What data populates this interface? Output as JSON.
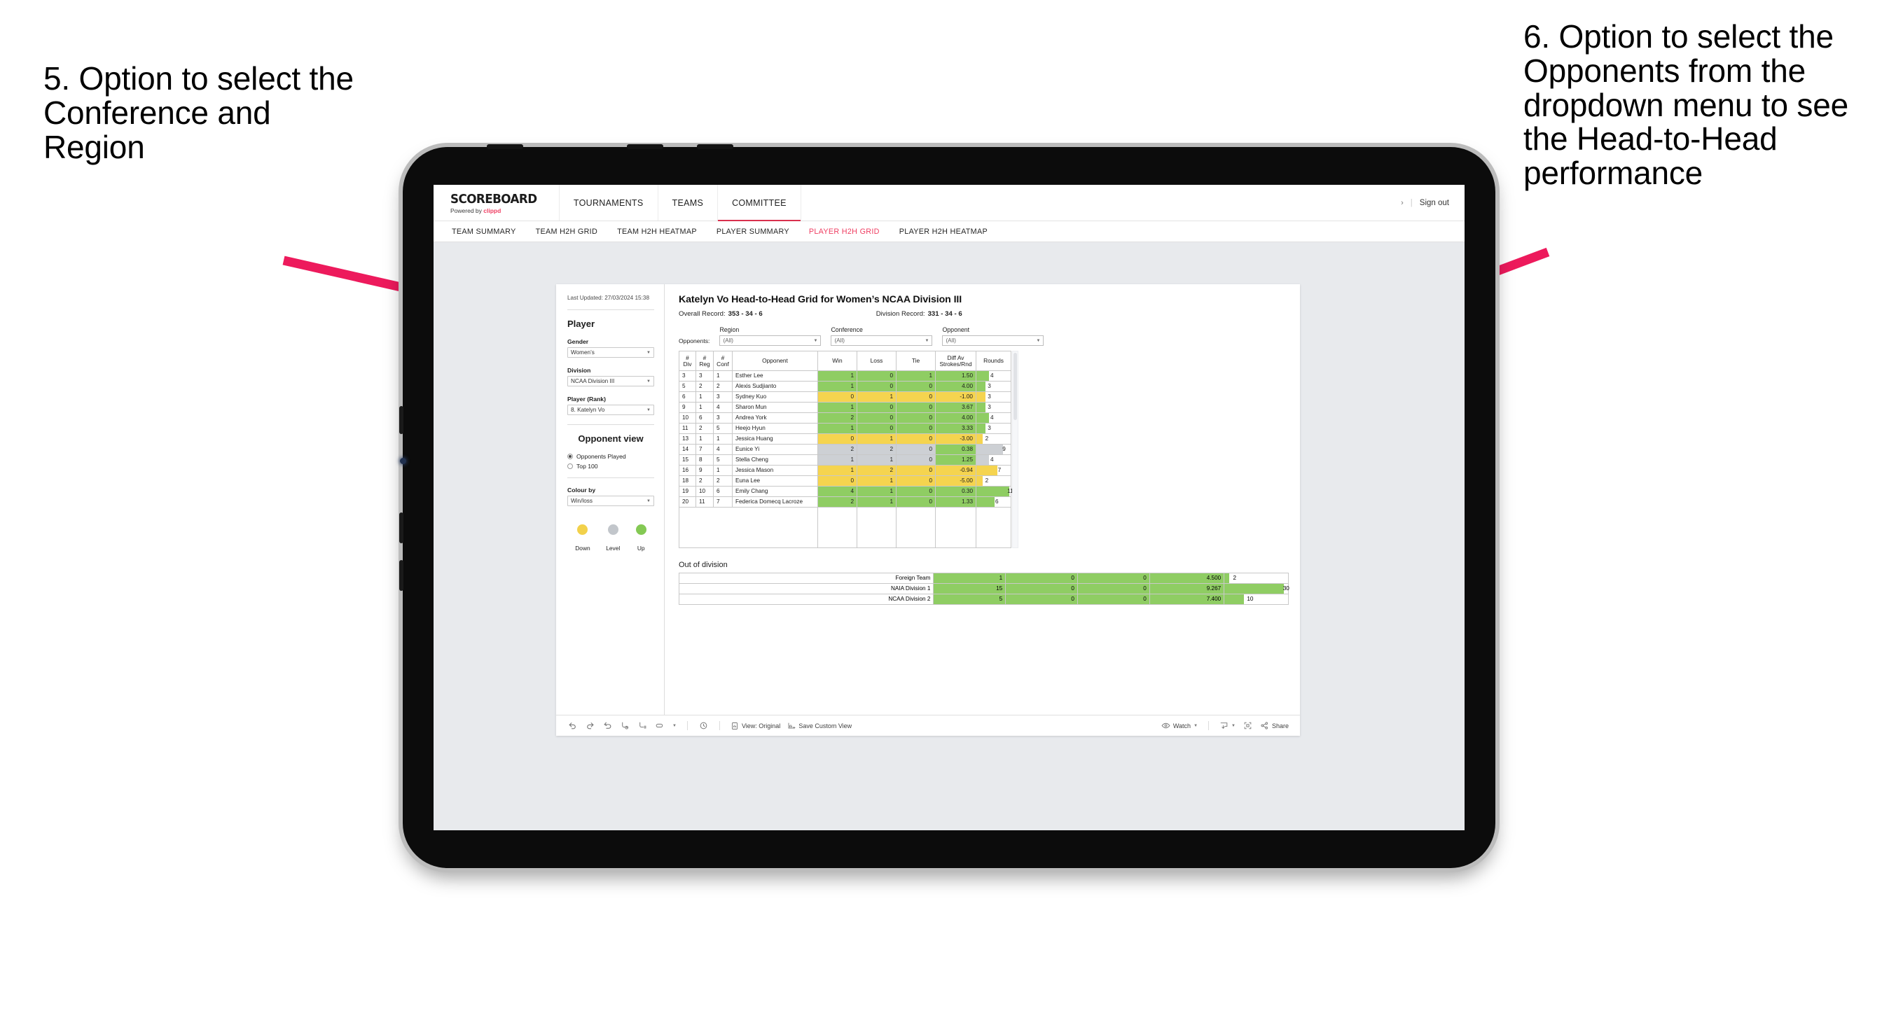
{
  "annotations": {
    "left": "5. Option to select the Conference and Region",
    "right": "6. Option to select the Opponents from the dropdown menu to see the Head-to-Head performance",
    "arrow_color": "#ed1a5c"
  },
  "app": {
    "brand": {
      "wordmark": "SCOREBOARD",
      "powered_prefix": "Powered by ",
      "powered_brand": "clippd"
    },
    "topnav": [
      {
        "label": "TOURNAMENTS",
        "active": false
      },
      {
        "label": "TEAMS",
        "active": false
      },
      {
        "label": "COMMITTEE",
        "active": true
      }
    ],
    "topright": {
      "chevron": "›",
      "separator": "|",
      "sign_out": "Sign out"
    },
    "subnav": [
      {
        "label": "TEAM SUMMARY",
        "active": false
      },
      {
        "label": "TEAM H2H GRID",
        "active": false
      },
      {
        "label": "TEAM H2H HEATMAP",
        "active": false
      },
      {
        "label": "PLAYER SUMMARY",
        "active": false
      },
      {
        "label": "PLAYER H2H GRID",
        "active": true
      },
      {
        "label": "PLAYER H2H HEATMAP",
        "active": false
      }
    ]
  },
  "sidebar": {
    "last_updated": "Last Updated: 27/03/2024 15:38",
    "player_heading": "Player",
    "fields": [
      {
        "label": "Gender",
        "value": "Women’s"
      },
      {
        "label": "Division",
        "value": "NCAA Division III"
      },
      {
        "label": "Player (Rank)",
        "value": "8. Katelyn Vo"
      }
    ],
    "opponent_view_heading": "Opponent view",
    "opponent_view_options": [
      {
        "label": "Opponents Played",
        "selected": true
      },
      {
        "label": "Top 100",
        "selected": false
      }
    ],
    "colour_by": {
      "label": "Colour by",
      "value": "Win/loss"
    },
    "legend": [
      {
        "label": "Down",
        "color": "#f2d14b"
      },
      {
        "label": "Level",
        "color": "#c2c6cb"
      },
      {
        "label": "Up",
        "color": "#84c954"
      }
    ]
  },
  "main": {
    "title": "Katelyn Vo Head-to-Head Grid for Women’s NCAA Division III",
    "overall_record_label": "Overall Record:",
    "overall_record_value": "353 - 34 - 6",
    "division_record_label": "Division Record:",
    "division_record_value": "331 - 34 - 6",
    "opponents_label": "Opponents:",
    "filters": [
      {
        "label": "Region",
        "value": "(All)"
      },
      {
        "label": "Conference",
        "value": "(All)"
      },
      {
        "label": "Opponent",
        "value": "(All)"
      }
    ],
    "out_of_division_heading": "Out of division"
  },
  "chart_data": {
    "type": "table",
    "title": "Katelyn Vo Head-to-Head Grid for Women’s NCAA Division III",
    "columns": [
      "# Div",
      "# Reg",
      "# Conf",
      "Opponent",
      "Win",
      "Loss",
      "Tie",
      "Diff Av Strokes/Rnd",
      "Rounds"
    ],
    "column_headers_split": [
      {
        "line1": "#",
        "line2": "Div"
      },
      {
        "line1": "#",
        "line2": "Reg"
      },
      {
        "line1": "#",
        "line2": "Conf"
      },
      {
        "line1": "Opponent",
        "line2": ""
      },
      {
        "line1": "Win",
        "line2": ""
      },
      {
        "line1": "Loss",
        "line2": ""
      },
      {
        "line1": "Tie",
        "line2": ""
      },
      {
        "line1": "Diff Av",
        "line2": "Strokes/Rnd"
      },
      {
        "line1": "Rounds",
        "line2": ""
      }
    ],
    "rows": [
      {
        "div": "3",
        "reg": "3",
        "conf": "1",
        "opponent": "Esther Lee",
        "win": "1",
        "loss": "0",
        "tie": "1",
        "diff": "1.50",
        "rounds": "4",
        "state": "up",
        "bar_pct": 36
      },
      {
        "div": "5",
        "reg": "2",
        "conf": "2",
        "opponent": "Alexis Sudjianto",
        "win": "1",
        "loss": "0",
        "tie": "0",
        "diff": "4.00",
        "rounds": "3",
        "state": "up",
        "bar_pct": 27
      },
      {
        "div": "6",
        "reg": "1",
        "conf": "3",
        "opponent": "Sydney Kuo",
        "win": "0",
        "loss": "1",
        "tie": "0",
        "diff": "-1.00",
        "rounds": "3",
        "state": "down",
        "bar_pct": 27
      },
      {
        "div": "9",
        "reg": "1",
        "conf": "4",
        "opponent": "Sharon Mun",
        "win": "1",
        "loss": "0",
        "tie": "0",
        "diff": "3.67",
        "rounds": "3",
        "state": "up",
        "bar_pct": 27
      },
      {
        "div": "10",
        "reg": "6",
        "conf": "3",
        "opponent": "Andrea York",
        "win": "2",
        "loss": "0",
        "tie": "0",
        "diff": "4.00",
        "rounds": "4",
        "state": "up",
        "bar_pct": 36
      },
      {
        "div": "11",
        "reg": "2",
        "conf": "5",
        "opponent": "Heejo Hyun",
        "win": "1",
        "loss": "0",
        "tie": "0",
        "diff": "3.33",
        "rounds": "3",
        "state": "up",
        "bar_pct": 27
      },
      {
        "div": "13",
        "reg": "1",
        "conf": "1",
        "opponent": "Jessica Huang",
        "win": "0",
        "loss": "1",
        "tie": "0",
        "diff": "-3.00",
        "rounds": "2",
        "state": "down",
        "bar_pct": 18
      },
      {
        "div": "14",
        "reg": "7",
        "conf": "4",
        "opponent": "Eunice Yi",
        "win": "2",
        "loss": "2",
        "tie": "0",
        "diff": "0.38",
        "rounds": "9",
        "state": "level",
        "diff_state": "up",
        "bar_pct": 78
      },
      {
        "div": "15",
        "reg": "8",
        "conf": "5",
        "opponent": "Stella Cheng",
        "win": "1",
        "loss": "1",
        "tie": "0",
        "diff": "1.25",
        "rounds": "4",
        "state": "level",
        "diff_state": "up",
        "bar_pct": 36
      },
      {
        "div": "16",
        "reg": "9",
        "conf": "1",
        "opponent": "Jessica Mason",
        "win": "1",
        "loss": "2",
        "tie": "0",
        "diff": "-0.94",
        "rounds": "7",
        "state": "down",
        "bar_pct": 62
      },
      {
        "div": "18",
        "reg": "2",
        "conf": "2",
        "opponent": "Euna Lee",
        "win": "0",
        "loss": "1",
        "tie": "0",
        "diff": "-5.00",
        "rounds": "2",
        "state": "down",
        "bar_pct": 18
      },
      {
        "div": "19",
        "reg": "10",
        "conf": "6",
        "opponent": "Emily Chang",
        "win": "4",
        "loss": "1",
        "tie": "0",
        "diff": "0.30",
        "rounds": "11",
        "state": "up",
        "bar_pct": 95
      },
      {
        "div": "20",
        "reg": "11",
        "conf": "7",
        "opponent": "Federica Domecq Lacroze",
        "win": "2",
        "loss": "1",
        "tie": "0",
        "diff": "1.33",
        "rounds": "6",
        "state": "up",
        "bar_pct": 53
      }
    ],
    "out_of_division": {
      "heading": "Out of division",
      "rows": [
        {
          "name": "Foreign Team",
          "win": "1",
          "loss": "0",
          "tie": "0",
          "diff": "4.500",
          "rounds": "2",
          "state": "up",
          "bar_pct": 7
        },
        {
          "name": "NAIA Division 1",
          "win": "15",
          "loss": "0",
          "tie": "0",
          "diff": "9.267",
          "rounds": "30",
          "state": "up",
          "bar_pct": 93
        },
        {
          "name": "NCAA Division 2",
          "win": "5",
          "loss": "0",
          "tie": "0",
          "diff": "7.400",
          "rounds": "10",
          "state": "up",
          "bar_pct": 31
        }
      ]
    },
    "colors": {
      "up": "#8fcd63",
      "down": "#f5d44f",
      "level": "#cdd0d4",
      "neutral": "#ffffff"
    }
  },
  "toolbar": {
    "icons": [
      "undo-icon",
      "redo-icon",
      "revert-icon",
      "refresh-icon",
      "pause-icon",
      "subscribe-icon"
    ],
    "view_label": "View: Original",
    "save_custom_view_label": "Save Custom View",
    "watch_label": "Watch",
    "share_label": "Share"
  }
}
